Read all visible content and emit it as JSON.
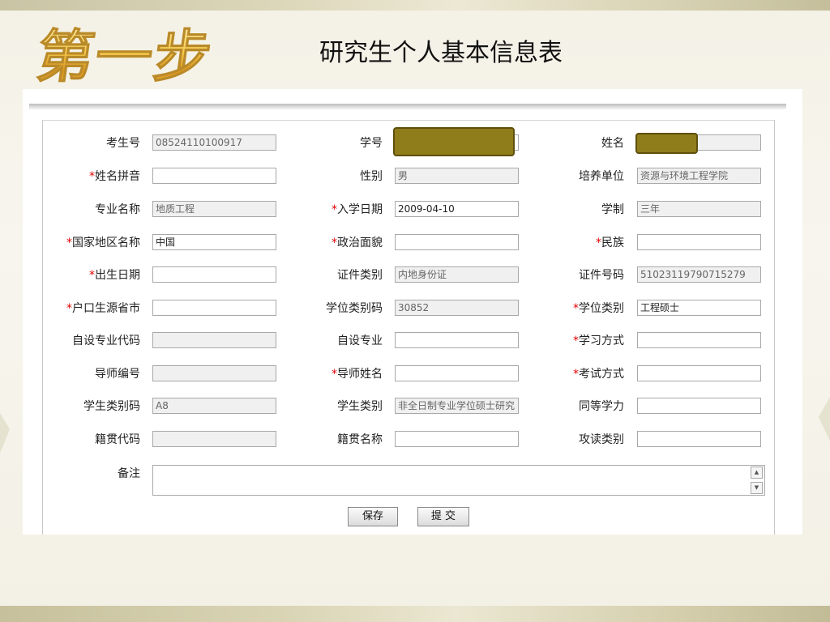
{
  "slide": {
    "step_title": "第一步",
    "page_title": "研究生个人基本信息表"
  },
  "colors": {
    "required_mark": "#e00000",
    "redaction": "#8f7d1c",
    "readonly_bg": "#f0f0f0"
  },
  "form": {
    "required_mark": "*",
    "rows": [
      [
        {
          "label": "考生号",
          "required": false,
          "value": "08524110100917",
          "readonly": true
        },
        {
          "label": "学号",
          "required": false,
          "value": "",
          "readonly": false,
          "redacted": true
        },
        {
          "label": "姓名",
          "required": false,
          "value": "",
          "readonly": true,
          "redacted": true
        }
      ],
      [
        {
          "label": "姓名拼音",
          "required": true,
          "value": "",
          "readonly": false
        },
        {
          "label": "性别",
          "required": false,
          "value": "男",
          "readonly": true
        },
        {
          "label": "培养单位",
          "required": false,
          "value": "资源与环境工程学院",
          "readonly": true
        }
      ],
      [
        {
          "label": "专业名称",
          "required": false,
          "value": "地质工程",
          "readonly": true
        },
        {
          "label": "入学日期",
          "required": true,
          "value": "2009-04-10",
          "readonly": false
        },
        {
          "label": "学制",
          "required": false,
          "value": "三年",
          "readonly": true
        }
      ],
      [
        {
          "label": "国家地区名称",
          "required": true,
          "value": "中国",
          "readonly": false
        },
        {
          "label": "政治面貌",
          "required": true,
          "value": "",
          "readonly": false
        },
        {
          "label": "民族",
          "required": true,
          "value": "",
          "readonly": false
        }
      ],
      [
        {
          "label": "出生日期",
          "required": true,
          "value": "",
          "readonly": false
        },
        {
          "label": "证件类别",
          "required": false,
          "value": "内地身份证",
          "readonly": true
        },
        {
          "label": "证件号码",
          "required": false,
          "value": "51023119790715279",
          "readonly": true
        }
      ],
      [
        {
          "label": "户口生源省市",
          "required": true,
          "value": "",
          "readonly": false
        },
        {
          "label": "学位类别码",
          "required": false,
          "value": "30852",
          "readonly": true
        },
        {
          "label": "学位类别",
          "required": true,
          "value": "工程硕士",
          "readonly": false
        }
      ],
      [
        {
          "label": "自设专业代码",
          "required": false,
          "value": "",
          "readonly": true
        },
        {
          "label": "自设专业",
          "required": false,
          "value": "",
          "readonly": false
        },
        {
          "label": "学习方式",
          "required": true,
          "value": "",
          "readonly": false
        }
      ],
      [
        {
          "label": "导师编号",
          "required": false,
          "value": "",
          "readonly": true
        },
        {
          "label": "导师姓名",
          "required": true,
          "value": "",
          "readonly": false
        },
        {
          "label": "考试方式",
          "required": true,
          "value": "",
          "readonly": false
        }
      ],
      [
        {
          "label": "学生类别码",
          "required": false,
          "value": "A8",
          "readonly": true
        },
        {
          "label": "学生类别",
          "required": false,
          "value": "非全日制专业学位硕士研究",
          "readonly": true
        },
        {
          "label": "同等学力",
          "required": false,
          "value": "",
          "readonly": false
        }
      ],
      [
        {
          "label": "籍贯代码",
          "required": false,
          "value": "",
          "readonly": true
        },
        {
          "label": "籍贯名称",
          "required": false,
          "value": "",
          "readonly": false
        },
        {
          "label": "攻读类别",
          "required": false,
          "value": "",
          "readonly": false
        }
      ]
    ],
    "remark_label": "备注",
    "remark_value": "",
    "scroll_up_icon": "▲",
    "scroll_down_icon": "▼",
    "save_label": "保存",
    "submit_label": "提 交"
  }
}
